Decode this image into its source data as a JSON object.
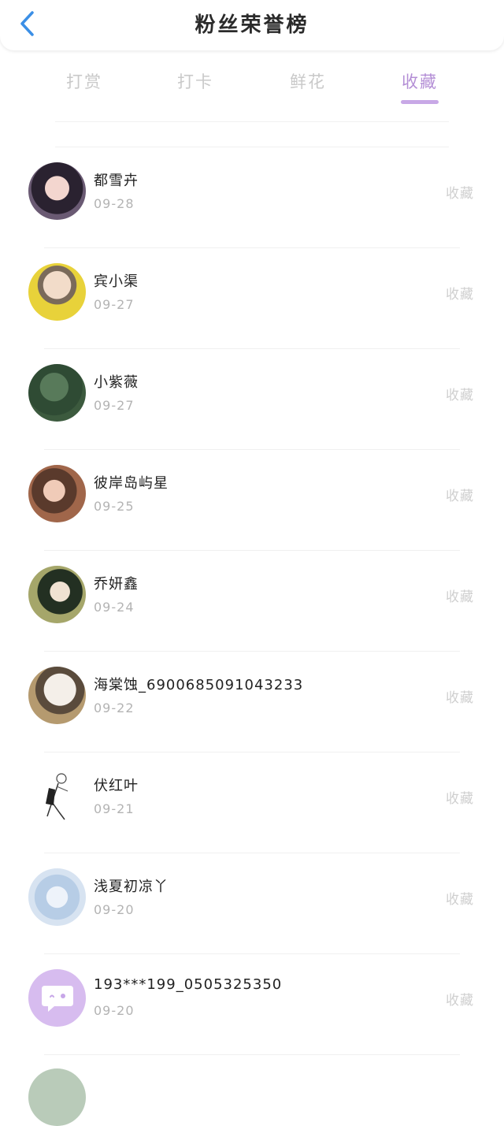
{
  "header": {
    "title": "粉丝荣誉榜",
    "back_icon": "chevron-left-icon"
  },
  "tabs": [
    {
      "label": "打赏"
    },
    {
      "label": "打卡"
    },
    {
      "label": "鲜花"
    },
    {
      "label": "收藏"
    }
  ],
  "active_tab": "收藏",
  "colors": {
    "accent": "#b48fd6",
    "back_icon": "#3b8fe6",
    "muted": "#c9c9c9"
  },
  "fans": [
    {
      "name": "都雪卉",
      "date": "09-28",
      "action": "收藏"
    },
    {
      "name": "宾小渠",
      "date": "09-27",
      "action": "收藏"
    },
    {
      "name": "小紫薇",
      "date": "09-27",
      "action": "收藏"
    },
    {
      "name": "彼岸岛屿星",
      "date": "09-25",
      "action": "收藏"
    },
    {
      "name": "乔妍鑫",
      "date": "09-24",
      "action": "收藏"
    },
    {
      "name": "海棠蚀_6900685091043233",
      "date": "09-22",
      "action": "收藏"
    },
    {
      "name": "伏红叶",
      "date": "09-21",
      "action": "收藏"
    },
    {
      "name": "浅夏初凉丫",
      "date": "09-20",
      "action": "收藏"
    },
    {
      "name": "193***199_0505325350",
      "date": "09-20",
      "action": "收藏"
    }
  ]
}
